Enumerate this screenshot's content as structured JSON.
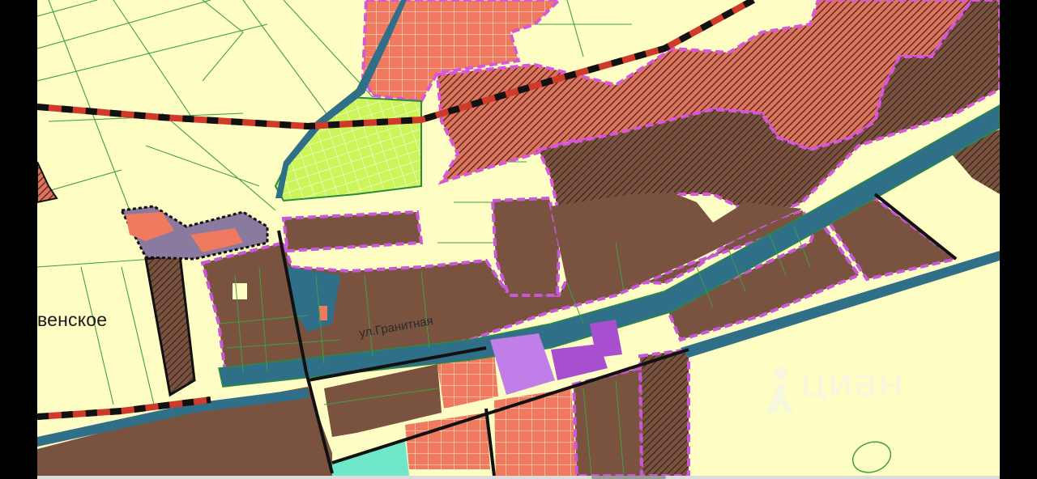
{
  "map": {
    "labels": {
      "place": "венское",
      "street": "ул.Гранитная"
    },
    "watermark": {
      "text": "циан",
      "icon": "cian-logo-icon"
    },
    "colors": {
      "background": "#fdfdc4",
      "residential_zone": "#ef7a5f",
      "industrial_zone": "#7a5240",
      "hatched_zone": "#5e3a2c",
      "garden_zone": "#ccf55a",
      "road_corridor": "#2f6f88",
      "public_zone": "#a84fd0",
      "zone_border": "#c858d8",
      "parcel_lines": "#2ea02e",
      "railway_dark": "#111111",
      "railway_red": "#d03a2a"
    }
  }
}
